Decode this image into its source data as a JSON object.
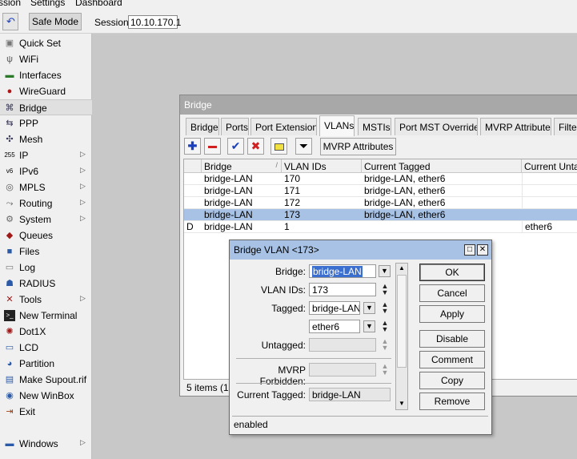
{
  "menu": {
    "items": [
      "ssion",
      "Settings",
      "Dashboard"
    ]
  },
  "toolbar": {
    "safe_mode_label": "Safe Mode",
    "session_label": "Session:",
    "session_value": "10.10.170.1"
  },
  "sidebar": {
    "items": [
      {
        "label": "Quick Set",
        "icon": "quick-set-icon",
        "submenu": false
      },
      {
        "label": "WiFi",
        "icon": "wifi-icon",
        "submenu": false
      },
      {
        "label": "Interfaces",
        "icon": "interfaces-icon",
        "submenu": false
      },
      {
        "label": "WireGuard",
        "icon": "wireguard-icon",
        "submenu": false
      },
      {
        "label": "Bridge",
        "icon": "bridge-icon",
        "submenu": false,
        "active": true
      },
      {
        "label": "PPP",
        "icon": "ppp-icon",
        "submenu": false
      },
      {
        "label": "Mesh",
        "icon": "mesh-icon",
        "submenu": false
      },
      {
        "label": "IP",
        "icon": "ip-icon",
        "submenu": true
      },
      {
        "label": "IPv6",
        "icon": "ipv6-icon",
        "submenu": true
      },
      {
        "label": "MPLS",
        "icon": "mpls-icon",
        "submenu": true
      },
      {
        "label": "Routing",
        "icon": "routing-icon",
        "submenu": true
      },
      {
        "label": "System",
        "icon": "system-icon",
        "submenu": true
      },
      {
        "label": "Queues",
        "icon": "queues-icon",
        "submenu": false
      },
      {
        "label": "Files",
        "icon": "files-icon",
        "submenu": false
      },
      {
        "label": "Log",
        "icon": "log-icon",
        "submenu": false
      },
      {
        "label": "RADIUS",
        "icon": "radius-icon",
        "submenu": false
      },
      {
        "label": "Tools",
        "icon": "tools-icon",
        "submenu": true
      },
      {
        "label": "New Terminal",
        "icon": "terminal-icon",
        "submenu": false
      },
      {
        "label": "Dot1X",
        "icon": "dot1x-icon",
        "submenu": false
      },
      {
        "label": "LCD",
        "icon": "lcd-icon",
        "submenu": false
      },
      {
        "label": "Partition",
        "icon": "partition-icon",
        "submenu": false
      },
      {
        "label": "Make Supout.rif",
        "icon": "supout-icon",
        "submenu": false
      },
      {
        "label": "New WinBox",
        "icon": "winbox-icon",
        "submenu": false
      },
      {
        "label": "Exit",
        "icon": "exit-icon",
        "submenu": false
      },
      {
        "label": "Windows",
        "icon": "windows-icon",
        "submenu": true
      }
    ]
  },
  "bridge_window": {
    "title": "Bridge",
    "tabs": [
      "Bridge",
      "Ports",
      "Port Extensions",
      "VLANs",
      "MSTIs",
      "Port MST Overrides",
      "MVRP Attributes",
      "Filters"
    ],
    "active_tab": "VLANs",
    "mvrp_button": "MVRP Attributes",
    "columns": [
      "",
      "Bridge",
      "VLAN IDs",
      "Current Tagged",
      "Current Untagged"
    ],
    "rows": [
      {
        "flag": "",
        "bridge": "bridge-LAN",
        "vlan_ids": "170",
        "tagged": "bridge-LAN, ether6",
        "untagged": ""
      },
      {
        "flag": "",
        "bridge": "bridge-LAN",
        "vlan_ids": "171",
        "tagged": "bridge-LAN, ether6",
        "untagged": ""
      },
      {
        "flag": "",
        "bridge": "bridge-LAN",
        "vlan_ids": "172",
        "tagged": "bridge-LAN, ether6",
        "untagged": ""
      },
      {
        "flag": "",
        "bridge": "bridge-LAN",
        "vlan_ids": "173",
        "tagged": "bridge-LAN, ether6",
        "untagged": "",
        "selected": true
      },
      {
        "flag": "D",
        "bridge": "bridge-LAN",
        "vlan_ids": "1",
        "tagged": "",
        "untagged": "ether6"
      }
    ],
    "status": "5 items (1 s"
  },
  "dialog": {
    "title": "Bridge VLAN <173>",
    "bridge_label": "Bridge:",
    "bridge_value": "bridge-LAN",
    "vlan_ids_label": "VLAN IDs:",
    "vlan_ids_value": "173",
    "tagged_label": "Tagged:",
    "tagged_values": [
      "bridge-LAN",
      "ether6"
    ],
    "untagged_label": "Untagged:",
    "mvrp_forbidden_label": "MVRP Forbidden:",
    "current_tagged_label": "Current Tagged:",
    "current_tagged_value": "bridge-LAN",
    "buttons": [
      "OK",
      "Cancel",
      "Apply",
      "Disable",
      "Comment",
      "Copy",
      "Remove"
    ],
    "status": "enabled"
  },
  "colors": {
    "selection": "#a7c2e5",
    "dialog_title": "#a7c2e5",
    "window_title": "#a8a8a8",
    "add_icon": "#1a3fbf",
    "remove_icon": "#d02020"
  }
}
